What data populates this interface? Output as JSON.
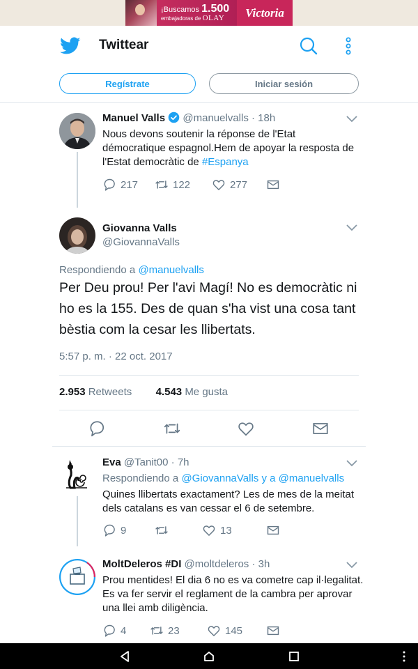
{
  "ad": {
    "line1_prefix": "¡Buscamos",
    "line1_number": "1.500",
    "line2_prefix": "embajadoras de",
    "line2_brand": "OLAY",
    "brand": "Victoria"
  },
  "header": {
    "title": "Twittear",
    "signup_label": "Regístrate",
    "login_label": "Iniciar sesión"
  },
  "tweets": [
    {
      "name": "Manuel Valls",
      "handle": "@manuelvalls",
      "time": "18h",
      "verified": true,
      "text_before": "Nous devons soutenir la réponse de l'Etat démocratique espagnol.Hem de apoyar la resposta de l'Estat democràtic de ",
      "hashtag": "#Espanya",
      "replies": "217",
      "retweets": "122",
      "likes": "277"
    },
    {
      "name": "Eva",
      "handle": "@Tanit00",
      "time": "7h",
      "reply_prefix": "Respondiendo a",
      "reply_to_1": "@GiovannaValls",
      "reply_joiner": "y a",
      "reply_to_2": "@manuelvalls",
      "text": "Quines llibertats exactament? Les de mes de la meitat dels catalans es van cessar el 6 de setembre.",
      "replies": "9",
      "retweets": "",
      "likes": "13"
    },
    {
      "name": "MoltDeleros #DI",
      "handle": "@moltdeleros",
      "time": "3h",
      "text": "Prou mentides! El dia 6 no es va cometre cap il·legalitat. Es va fer servir el reglament de la cambra per aprovar una llei amb diligència.",
      "replies": "4",
      "retweets": "23",
      "likes": "145"
    }
  ],
  "focused": {
    "name": "Giovanna Valls",
    "handle": "@GiovannaValls",
    "reply_prefix": "Respondiendo a",
    "reply_to": "@manuelvalls",
    "text": "Per Deu prou! Per l'avi Magí! No es democràtic ni ho es la 155. Des de quan s'ha vist una cosa tant bèstia com la cesar les llibertats.",
    "timestamp": "5:57 p. m. · 22 oct. 2017",
    "retweets_count": "2.953",
    "retweets_label": "Retweets",
    "likes_count": "4.543",
    "likes_label": "Me gusta"
  },
  "icons": {
    "logo": "twitter-bird-icon",
    "search": "search-icon",
    "more": "more-vertical-icon",
    "reply": "reply-icon",
    "retweet": "retweet-icon",
    "like": "heart-icon",
    "dm": "envelope-icon",
    "back": "back-triangle-icon",
    "home": "home-circle-icon",
    "recents": "recents-square-icon"
  },
  "colors": {
    "accent": "#1da1f2",
    "secondary_text": "#657786",
    "verified": "#1da1f2"
  }
}
